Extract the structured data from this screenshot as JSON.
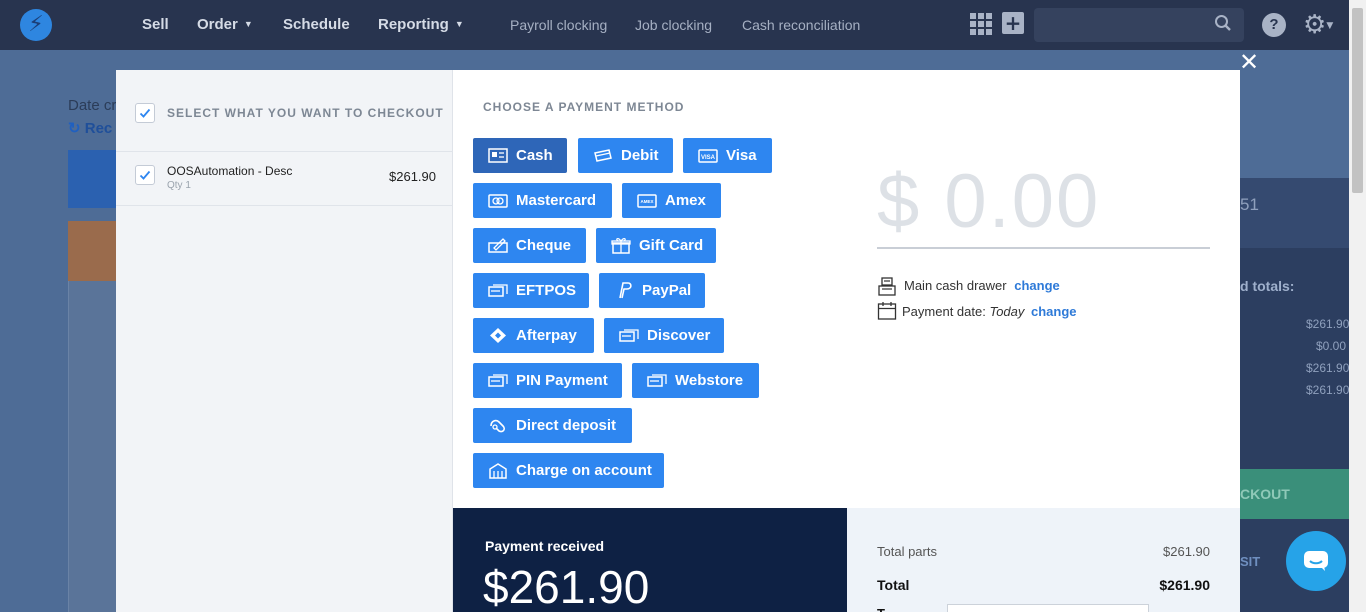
{
  "nav": {
    "main": [
      {
        "label": "Sell",
        "caret": false
      },
      {
        "label": "Order",
        "caret": true
      },
      {
        "label": "Schedule",
        "caret": false
      },
      {
        "label": "Reporting",
        "caret": true
      }
    ],
    "sub": [
      "Payroll clocking",
      "Job clocking",
      "Cash reconciliation"
    ],
    "icons": [
      "apps-grid-icon",
      "plus-icon",
      "search-icon",
      "help-icon",
      "gear-icon"
    ],
    "help_label": "?"
  },
  "background": {
    "date_label": "Date cr",
    "recent_label": "Rec",
    "right_value": "51",
    "totals_label": "d totals:",
    "right_values": [
      "$261.90",
      "$0.00",
      "$261.90",
      "$261.90"
    ],
    "checkout_label": "CKOUT",
    "deposit_label": "SIT"
  },
  "checkout_panel": {
    "header": "SELECT WHAT YOU WANT TO CHECKOUT",
    "items": [
      {
        "name": "OOSAutomation - Desc",
        "qty": "Qty 1",
        "price": "$261.90",
        "checked": true
      }
    ]
  },
  "payment": {
    "title": "CHOOSE A PAYMENT METHOD",
    "methods": [
      {
        "label": "Cash",
        "icon": "cash-icon",
        "active": true
      },
      {
        "label": "Debit",
        "icon": "debit-card-icon",
        "active": false
      },
      {
        "label": "Visa",
        "icon": "visa-icon",
        "active": false
      },
      {
        "label": "Mastercard",
        "icon": "mastercard-icon",
        "active": false
      },
      {
        "label": "Amex",
        "icon": "amex-icon",
        "active": false
      },
      {
        "label": "Cheque",
        "icon": "cheque-icon",
        "active": false
      },
      {
        "label": "Gift Card",
        "icon": "gift-card-icon",
        "active": false
      },
      {
        "label": "EFTPOS",
        "icon": "eftpos-icon",
        "active": false
      },
      {
        "label": "PayPal",
        "icon": "paypal-icon",
        "active": false
      },
      {
        "label": "Afterpay",
        "icon": "afterpay-icon",
        "active": false
      },
      {
        "label": "Discover",
        "icon": "discover-icon",
        "active": false
      },
      {
        "label": "PIN Payment",
        "icon": "pin-payment-icon",
        "active": false
      },
      {
        "label": "Webstore",
        "icon": "webstore-icon",
        "active": false
      },
      {
        "label": "Direct deposit",
        "icon": "direct-deposit-icon",
        "active": false
      },
      {
        "label": "Charge on account",
        "icon": "charge-account-icon",
        "active": false
      }
    ],
    "amount": "$ 0.00",
    "drawer_label": "Main cash drawer",
    "change_label": "change",
    "date_prefix": "Payment date:",
    "date_value": "Today"
  },
  "summary": {
    "received_label": "Payment received",
    "received_value": "$261.90",
    "total_parts_label": "Total parts",
    "total_parts_value": "$261.90",
    "total_label": "Total",
    "total_value": "$261.90",
    "tendered_label": "T"
  },
  "colors": {
    "nav_bg": "#28344f",
    "accent": "#2e86f0",
    "active_method": "#2e66b8",
    "received_bg": "#0e2144",
    "chat": "#26a3e8"
  }
}
